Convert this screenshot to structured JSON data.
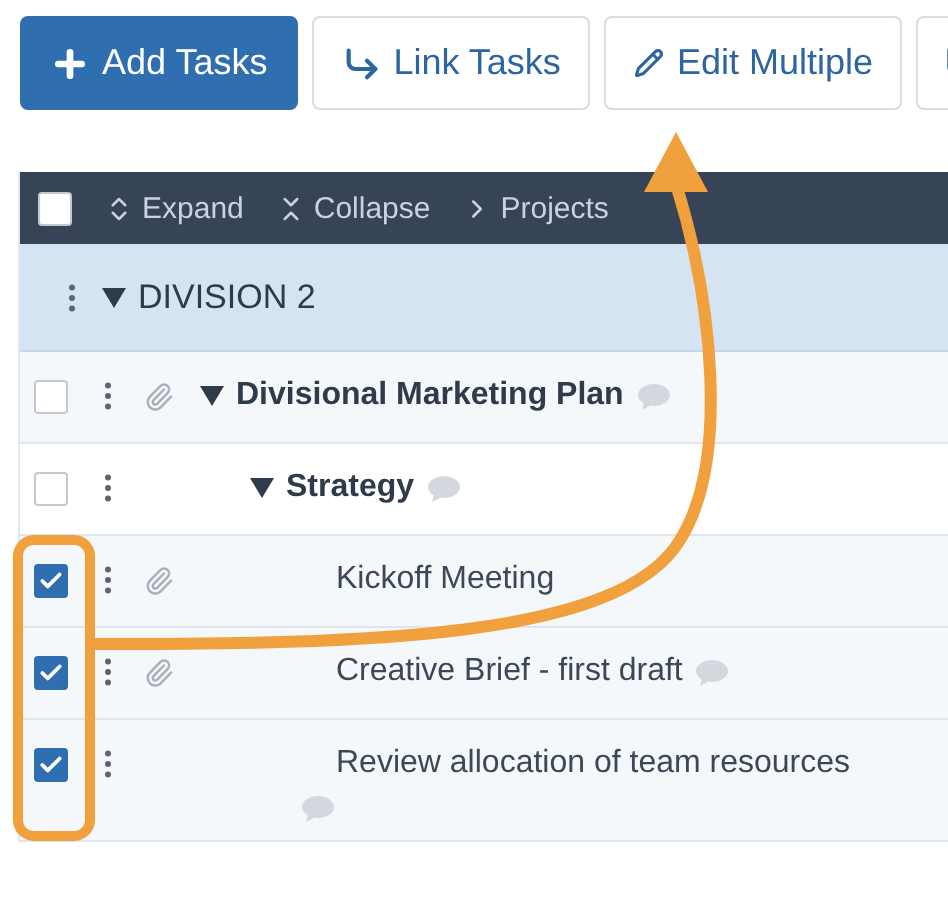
{
  "toolbar": [
    {
      "kind": "plus",
      "label": "Add Tasks",
      "primary": true
    },
    {
      "kind": "link",
      "label": "Link Tasks",
      "primary": false
    },
    {
      "kind": "edit",
      "label": "Edit Multiple",
      "primary": false
    },
    {
      "kind": "copy",
      "primary": false
    }
  ],
  "table_header": {
    "select_all": {
      "checked": false
    },
    "actions": [
      {
        "kind": "expand",
        "label": "Expand"
      },
      {
        "kind": "collapse",
        "label": "Collapse"
      },
      {
        "kind": "projects",
        "label": "Projects"
      }
    ]
  },
  "group": {
    "label": "DIVISION 2",
    "expanded": true,
    "tasks": [
      {
        "title": "Divisional Marketing Plan",
        "checked": false,
        "attachment": true,
        "comment": true,
        "expanded": true,
        "children": [
          {
            "title": "Strategy",
            "checked": false,
            "attachment": false,
            "comment": true,
            "expanded": true,
            "children": [
              {
                "title": "Kickoff Meeting",
                "checked": true,
                "attachment": true,
                "comment": false
              },
              {
                "title": "Creative Brief - first draft",
                "checked": true,
                "attachment": true,
                "comment": true
              },
              {
                "title": "Review allocation of team resources",
                "checked": true,
                "attachment": false,
                "comment": true
              }
            ]
          }
        ]
      }
    ]
  }
}
